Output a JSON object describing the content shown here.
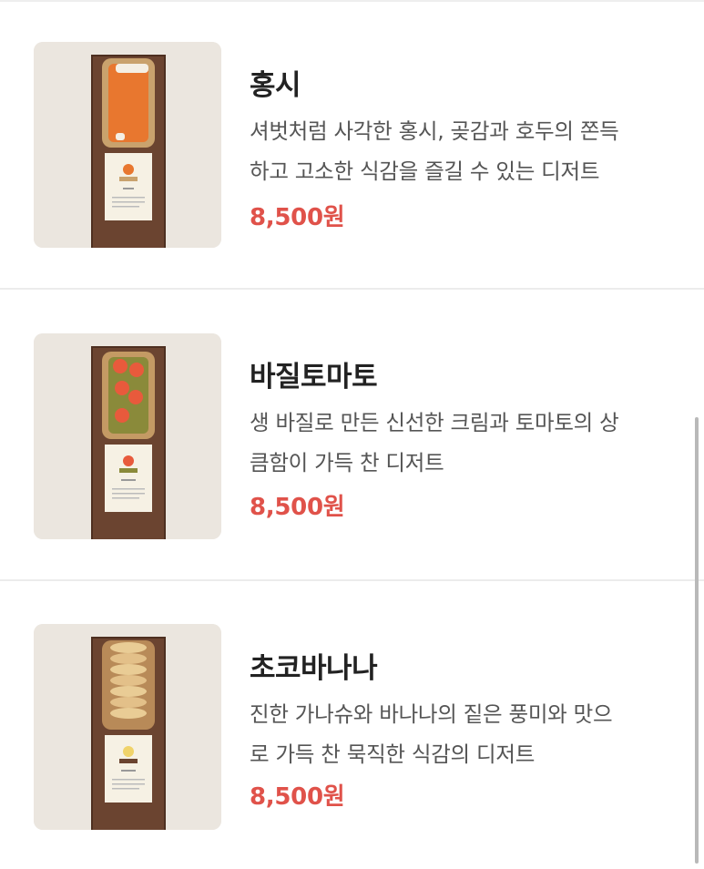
{
  "items": [
    {
      "name": "홍시",
      "description_line1": "셔벗처럼 사각한 홍시, 곶감과 호두의 쫀득",
      "description_line2": "하고 고소한 식감을 즐길 수 있는 디저트",
      "price": "8,500원",
      "image": "persimmon-dessert-photo",
      "card_brand": "Plants & Ginger",
      "card_title": "홍시"
    },
    {
      "name": "바질토마토",
      "description_line1": "생 바질로 만든 신선한 크림과 토마토의 상",
      "description_line2": "큼함이 가득 찬 디저트",
      "price": "8,500원",
      "image": "basil-tomato-dessert-photo",
      "card_brand": "Plants & Ginger",
      "card_title": "바질토마토"
    },
    {
      "name": "초코바나나",
      "description_line1": "진한 가나슈와 바나나의 짙은 풍미와 맛으",
      "description_line2": "로 가득 찬 묵직한 식감의 디저트",
      "price": "8,500원",
      "image": "choco-banana-dessert-photo",
      "card_brand": "Plants & Ginger",
      "card_title": "초코바나나"
    }
  ],
  "colors": {
    "price": "#e0524a",
    "name": "#222222",
    "description": "#555555",
    "divider": "#ececec"
  }
}
